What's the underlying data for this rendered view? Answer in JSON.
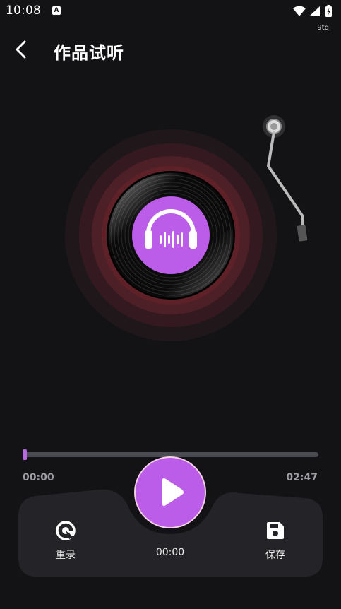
{
  "status_bar": {
    "time": "10:08",
    "notification_icon": "A",
    "sub_label": "9tq",
    "icons": [
      "wifi-icon",
      "signal-icon",
      "battery-charging-icon"
    ]
  },
  "header": {
    "back_icon": "chevron-left-icon",
    "title": "作品试听"
  },
  "player": {
    "progress": 0.0,
    "start_time": "00:00",
    "end_time": "02:47",
    "current_time": "00:00",
    "center_icon": "headphones-icon",
    "accent_color": "#bb5de8"
  },
  "controls": {
    "rerecord_label": "重录",
    "save_label": "保存",
    "rerecord_icon": "rerecord-icon",
    "save_icon": "save-icon",
    "play_icon": "play-icon"
  }
}
